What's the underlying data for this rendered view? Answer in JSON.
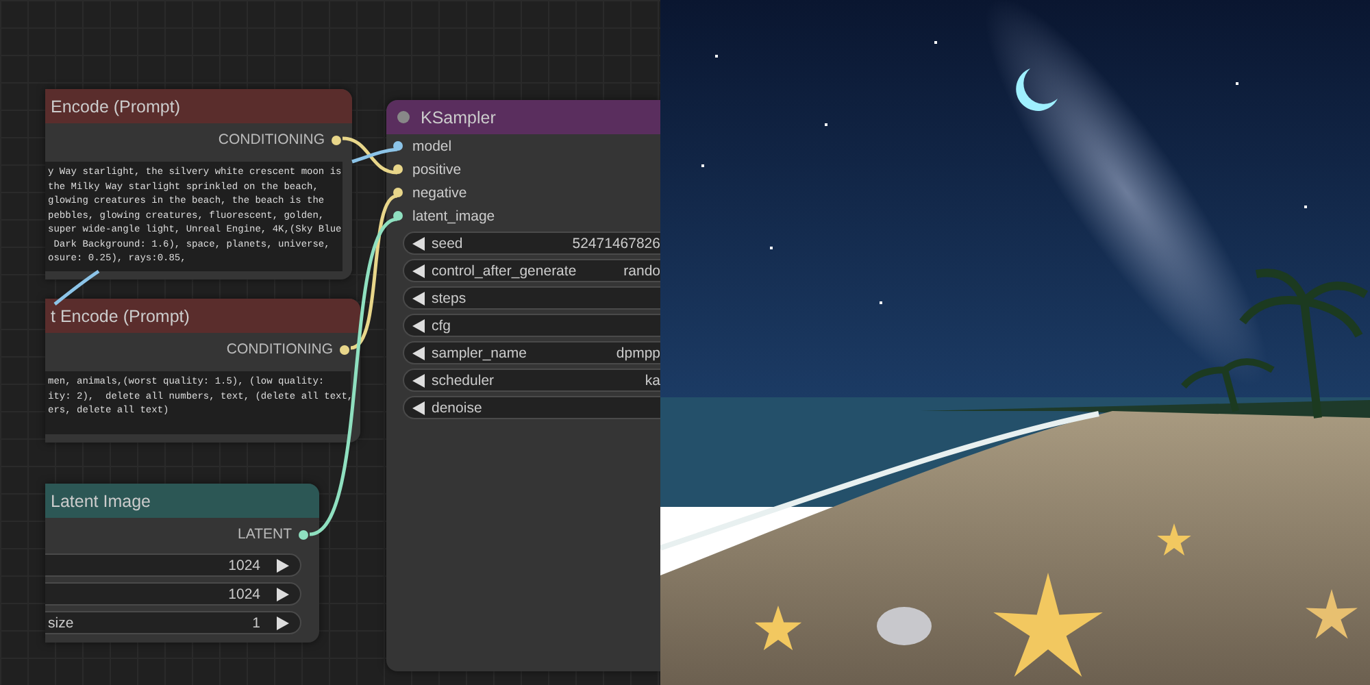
{
  "nodes": [
    {
      "kind": "prompt",
      "title": "Encode (Prompt)",
      "color": "#5a2d2c",
      "output": {
        "name": "CONDITIONING",
        "color": "#e8d68a"
      },
      "text": "y Way starlight, the silvery white crescent moon is\nthe Milky Way starlight sprinkled on the beach,\nglowing creatures in the beach, the beach is the\npebbles, glowing creatures, fluorescent, golden,\nsuper wide-angle light, Unreal Engine, 4K,(Sky Blue\n Dark Background: 1.6), space, planets, universe,\nosure: 0.25), rays:0.85,"
    },
    {
      "kind": "prompt",
      "title": "t Encode (Prompt)",
      "color": "#5a2d2c",
      "output": {
        "name": "CONDITIONING",
        "color": "#e8d68a"
      },
      "text": "men, animals,(worst quality: 1.5), (low quality:\nity: 2),  delete all numbers, text, (delete all text,\ners, delete all text)"
    },
    {
      "kind": "latent",
      "title": "Latent Image",
      "color": "#2c5755",
      "output": {
        "name": "LATENT",
        "color": "#8fe0c0"
      },
      "widgets": [
        {
          "value": "1024"
        },
        {
          "value": "1024"
        },
        {
          "label": "size",
          "value": "1"
        }
      ]
    },
    {
      "kind": "sampler",
      "title": "KSampler",
      "color": "#5a2e5e",
      "inputs": [
        {
          "name": "model",
          "color": "#8cc4e8"
        },
        {
          "name": "positive",
          "color": "#e8d68a"
        },
        {
          "name": "negative",
          "color": "#e8d68a"
        },
        {
          "name": "latent_image",
          "color": "#8fe0c0"
        }
      ],
      "widgets": [
        {
          "label": "seed",
          "value": "52471467826"
        },
        {
          "label": "control_after_generate",
          "value": "rando"
        },
        {
          "label": "steps"
        },
        {
          "label": "cfg"
        },
        {
          "label": "sampler_name",
          "value": "dpmpp"
        },
        {
          "label": "scheduler",
          "value": "ka"
        },
        {
          "label": "denoise"
        }
      ]
    }
  ]
}
